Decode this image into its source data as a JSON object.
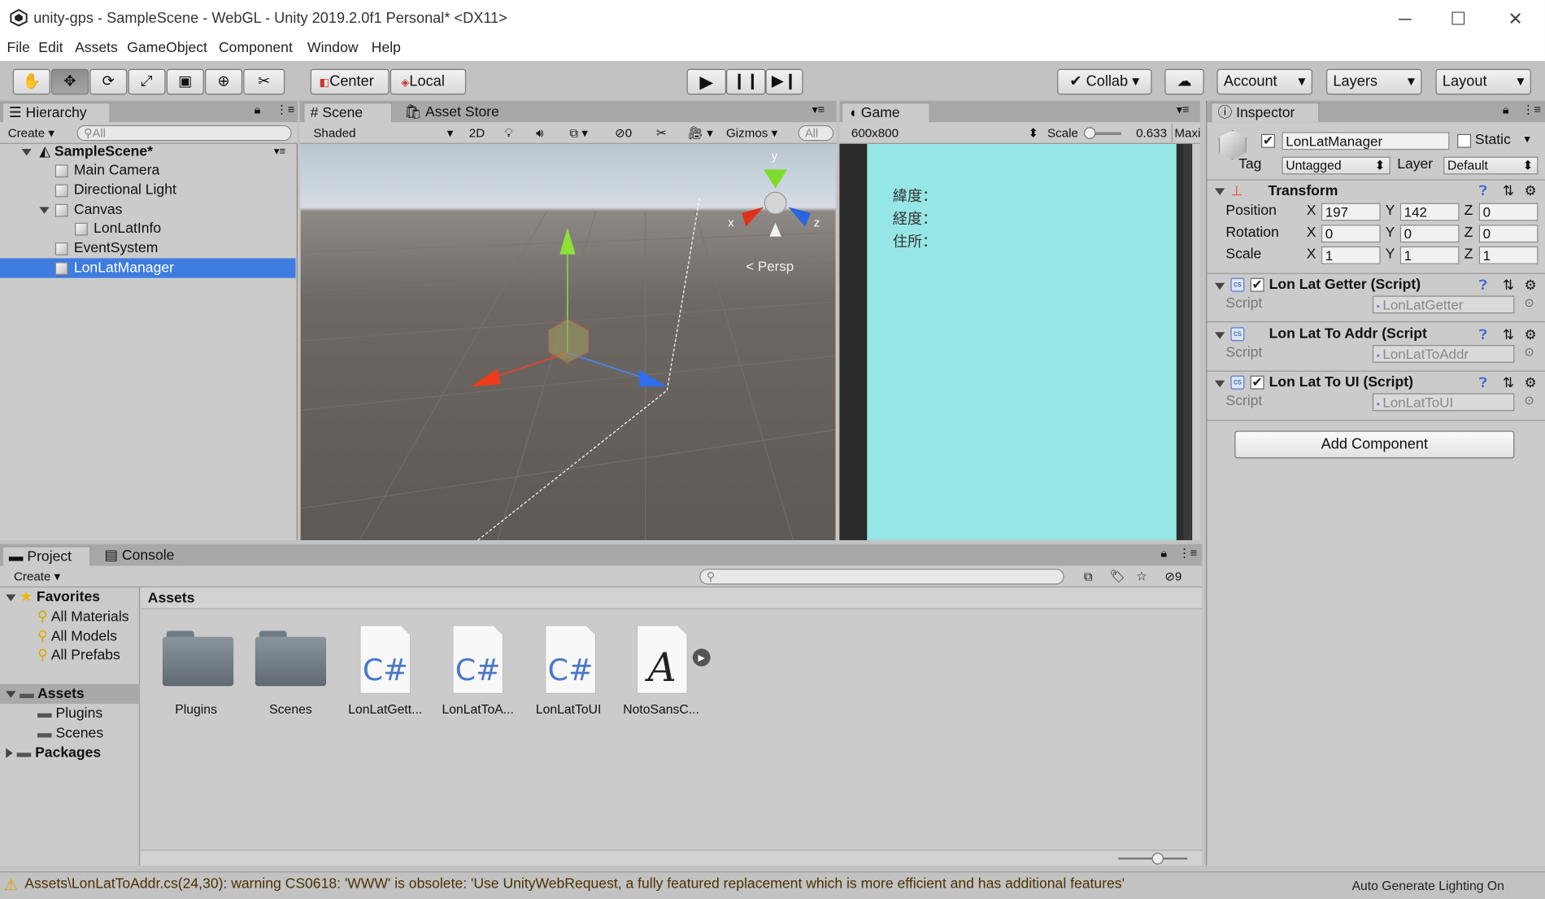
{
  "window": {
    "title": "unity-gps - SampleScene - WebGL - Unity 2019.2.0f1 Personal* <DX11>",
    "minimize": "─",
    "maximize": "☐",
    "close": "✕"
  },
  "menu": [
    "File",
    "Edit",
    "Assets",
    "GameObject",
    "Component",
    "Window",
    "Help"
  ],
  "toolbar": {
    "pivot": "Center",
    "space": "Local",
    "collab": "Collab ▾",
    "account": "Account",
    "layers": "Layers",
    "layout": "Layout"
  },
  "hierarchy": {
    "tab": "Hierarchy",
    "create": "Create",
    "search_placeholder": "All",
    "scene": "SampleScene*",
    "items": [
      {
        "label": "Main Camera"
      },
      {
        "label": "Directional Light"
      },
      {
        "label": "Canvas"
      },
      {
        "label": "LonLatInfo"
      },
      {
        "label": "EventSystem"
      },
      {
        "label": "LonLatManager"
      }
    ]
  },
  "scene_view": {
    "tab": "Scene",
    "tab2": "Asset Store",
    "shading": "Shaded",
    "mode2d": "2D",
    "hidden_count": "0",
    "gizmos": "Gizmos",
    "search": "All",
    "persp": "Persp",
    "axis_x": "x",
    "axis_y": "y",
    "axis_z": "z"
  },
  "game_view": {
    "tab": "Game",
    "resolution": "600x800",
    "scale_label": "Scale",
    "scale_value": "0.633",
    "maximize": "Maxir",
    "lines": [
      "緯度：",
      "経度：",
      "住所："
    ]
  },
  "inspector": {
    "tab": "Inspector",
    "object_name": "LonLatManager",
    "static_label": "Static",
    "tag_label": "Tag",
    "tag_value": "Untagged",
    "layer_label": "Layer",
    "layer_value": "Default",
    "transform": {
      "title": "Transform",
      "rows": [
        {
          "label": "Position",
          "x": "197",
          "y": "142",
          "z": "0"
        },
        {
          "label": "Rotation",
          "x": "0",
          "y": "0",
          "z": "0"
        },
        {
          "label": "Scale",
          "x": "1",
          "y": "1",
          "z": "1"
        }
      ]
    },
    "components": [
      {
        "title": "Lon Lat Getter (Script)",
        "script_label": "Script",
        "script": "LonLatGetter",
        "checkbox": true
      },
      {
        "title": "Lon Lat To Addr (Script",
        "script_label": "Script",
        "script": "LonLatToAddr",
        "checkbox": false
      },
      {
        "title": "Lon Lat To UI (Script)",
        "script_label": "Script",
        "script": "LonLatToUI",
        "checkbox": true
      }
    ],
    "add_component": "Add Component"
  },
  "project": {
    "tab": "Project",
    "tab2": "Console",
    "create": "Create",
    "filter_count": "9",
    "favorites": "Favorites",
    "fav_items": [
      "All Materials",
      "All Models",
      "All Prefabs"
    ],
    "assets_root": "Assets",
    "asset_folders": [
      "Plugins",
      "Scenes"
    ],
    "packages": "Packages",
    "breadcrumb": "Assets",
    "assets": [
      {
        "label": "Plugins",
        "kind": "folder"
      },
      {
        "label": "Scenes",
        "kind": "folder"
      },
      {
        "label": "LonLatGett...",
        "kind": "cs"
      },
      {
        "label": "LonLatToA...",
        "kind": "cs"
      },
      {
        "label": "LonLatToUI",
        "kind": "cs"
      },
      {
        "label": "NotoSansC...",
        "kind": "font"
      }
    ],
    "cs_glyph": "C#",
    "font_glyph": "A"
  },
  "status": {
    "warning": "Assets\\LonLatToAddr.cs(24,30): warning CS0618: 'WWW' is obsolete: 'Use UnityWebRequest, a fully featured replacement which is more efficient and has additional features'",
    "right": "Auto Generate Lighting On"
  },
  "colors": {
    "selection": "#3e7ce0",
    "game_bg": "#97e6e6",
    "scene_sky": "#c9d3da",
    "scene_ground": "#5f5955"
  }
}
